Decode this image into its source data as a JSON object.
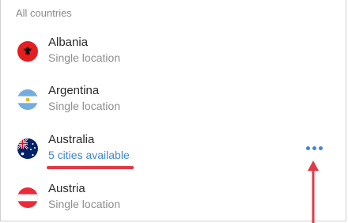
{
  "section_header": "All countries",
  "countries": [
    {
      "name": "Albania",
      "subtitle": "Single location",
      "flag_icon": "albania-flag-icon"
    },
    {
      "name": "Argentina",
      "subtitle": "Single location",
      "flag_icon": "argentina-flag-icon"
    },
    {
      "name": "Australia",
      "subtitle": "5 cities available",
      "flag_icon": "australia-flag-icon"
    },
    {
      "name": "Austria",
      "subtitle": "Single location",
      "flag_icon": "austria-flag-icon"
    }
  ],
  "more_button_icon": "more-options-icon",
  "colors": {
    "link": "#3f86d2",
    "annotation": "#e23a45",
    "muted_text": "#8d8d8d"
  }
}
